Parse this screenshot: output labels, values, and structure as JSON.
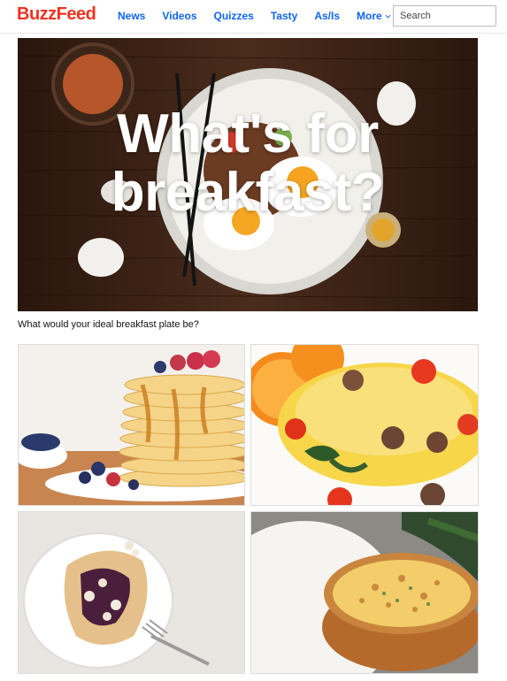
{
  "header": {
    "logo": "BuzzFeed",
    "nav": [
      "News",
      "Videos",
      "Quizzes",
      "Tasty",
      "As/Is",
      "More"
    ],
    "search_placeholder": "Search"
  },
  "hero": {
    "title_line1": "What's for",
    "title_line2": "breakfast?"
  },
  "question": "What would your ideal breakfast plate be?",
  "options": [
    {
      "icon": "pancake-stack-photo"
    },
    {
      "icon": "omelette-photo"
    },
    {
      "icon": "crepe-photo"
    },
    {
      "icon": "quiche-photo"
    }
  ],
  "colors": {
    "brand": "#ee3322",
    "nav_link": "#0f65ef"
  }
}
